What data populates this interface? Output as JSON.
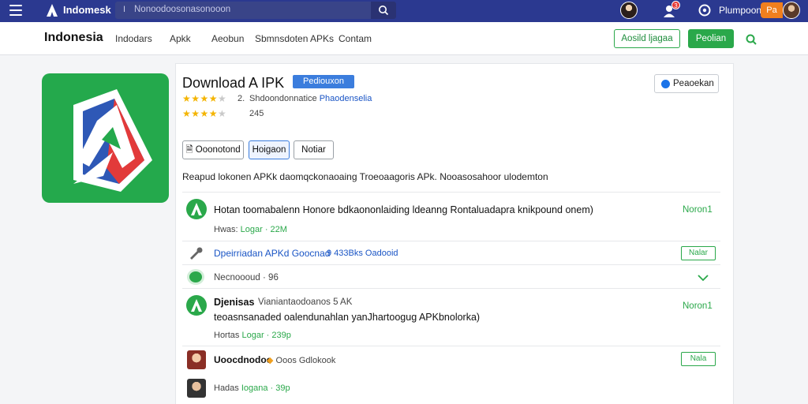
{
  "topbar": {
    "brand": "Indomesk",
    "search_lead": "I",
    "search_placeholder": "Nonoodoosonasonooon",
    "badge_count": "3",
    "label": "Plumpoon",
    "cta": "Pa"
  },
  "nav": {
    "site_title": "Indonesia",
    "links": [
      "Indodars",
      "Apkk",
      "Aeobun",
      "Sbmnsdoten APKs",
      "Contam"
    ],
    "outline_button": "Aosild ljagaa",
    "green_button": "Peolian"
  },
  "app": {
    "title": "Download A IPK",
    "title_badge": "Pediouxon",
    "follow_label": "Peaoekan",
    "rating1_value": "2.",
    "rating1_text": "Shdoondonnatice",
    "rating1_link": "Phaodenselia",
    "rating2_value": "245",
    "buttons": [
      "Ooonotond",
      "Hoigaon",
      "Notiar"
    ],
    "description": "Reapud lokonen APKk daomqckonaoaing Troeoaagoris APk. Nooasosahoor ulodemton"
  },
  "rows": [
    {
      "text": "Hotan toomabalenn Honore bdkaononlaiding ldeanng Rontaluadapra knikpound onem)",
      "meta_label": "Hwas:",
      "meta_value": "Logar · 22M",
      "right": "Noron1"
    },
    {
      "link": "Dpeirriadan APKd Goocnad",
      "link_meta": "9 433Bks Oadooid",
      "button": "Nalar"
    },
    {
      "text": "Necnoooud · 96"
    },
    {
      "name": "Djenisas",
      "line1": "Vianiantaodoanos 5 AK",
      "line2": "teoasnsanaded oalendunahlan yanJhartoogug APKbnolorka)",
      "meta_label": "Hortas",
      "meta_value": "Logar · 239p",
      "right": "Noron1"
    },
    {
      "text": "Uoocdnodoo",
      "meta_text": "Ooos Gdlokook",
      "button": "Nala"
    },
    {
      "meta_label": "Hadas",
      "meta_value": "Iogana · 39p"
    }
  ],
  "colors": {
    "topbar": "#2b3990",
    "green": "#2aa84a",
    "blue": "#3b7ddd",
    "orange": "#f07f1e",
    "red": "#e23a3a"
  }
}
